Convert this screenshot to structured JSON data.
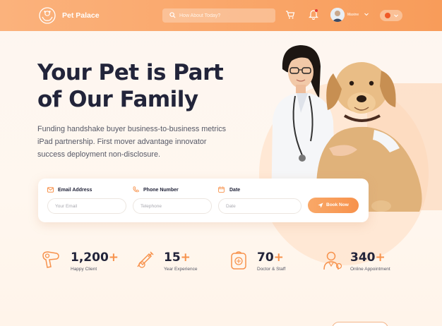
{
  "header": {
    "brand": "Pet Palace",
    "search_placeholder": "How About Today?",
    "user_name": "Maxine"
  },
  "hero": {
    "title": "Your Pet is Part of Our Family",
    "description": "Funding handshake buyer business-to-business metrics iPad partnership. First mover advantage innovator success deployment non-disclosure."
  },
  "booking": {
    "email_label": "Email Address",
    "email_placeholder": "Your Email",
    "phone_label": "Phone Number",
    "phone_placeholder": "Telephone",
    "date_label": "Date",
    "date_placeholder": "Date",
    "button_label": "Book Now"
  },
  "stats": [
    {
      "number": "1,200",
      "plus": "+",
      "label": "Happy Client",
      "icon": "hair-dryer-icon"
    },
    {
      "number": "15",
      "plus": "+",
      "label": "Year Experience",
      "icon": "vaccine-syringe-icon"
    },
    {
      "number": "70",
      "plus": "+",
      "label": "Doctor & Staff",
      "icon": "pet-carrier-icon"
    },
    {
      "number": "340",
      "plus": "+",
      "label": "Online Appointment",
      "icon": "vet-doctor-icon"
    }
  ],
  "colors": {
    "accent": "#f7924c",
    "header_start": "#fbb27c",
    "header_end": "#f89c5a",
    "title": "#22243a"
  }
}
